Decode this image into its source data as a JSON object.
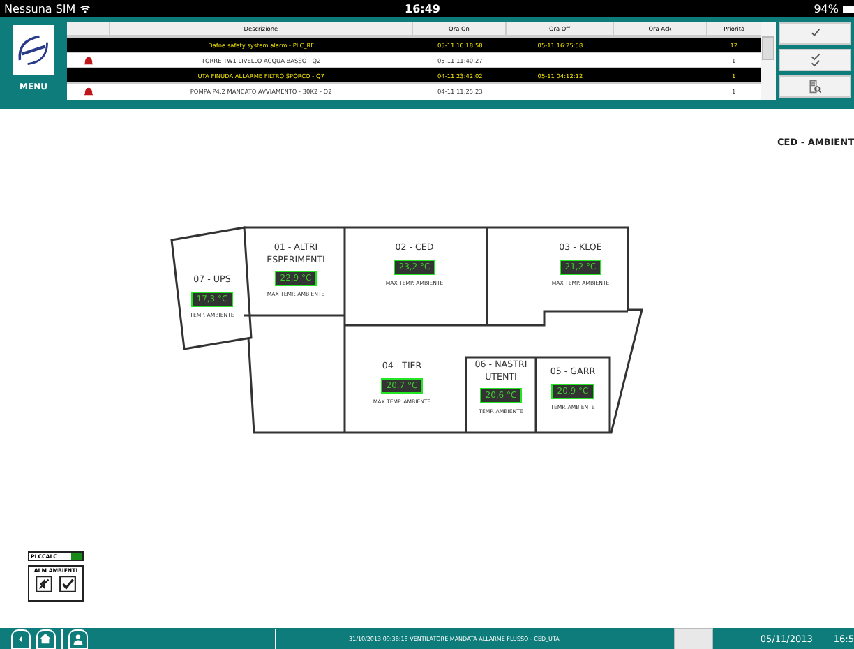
{
  "status_bar": {
    "carrier": "Nessuna SIM",
    "time": "16:49",
    "battery": "94%"
  },
  "menu": {
    "label": "MENU"
  },
  "alarms": {
    "columns": [
      "Descrizione",
      "Ora On",
      "Ora Off",
      "Ora Ack",
      "Priorità"
    ],
    "rows": [
      {
        "kind": "unacked",
        "description": "Dafne safety system alarm - PLC_RF",
        "on": "05-11 16:18:58",
        "off": "05-11 16:25:58",
        "ack": "",
        "priority": "12"
      },
      {
        "kind": "active",
        "description": "TORRE TW1 LIVELLO ACQUA BASSO - Q2",
        "on": "05-11 11:40:27",
        "off": "",
        "ack": "",
        "priority": "1"
      },
      {
        "kind": "unacked",
        "description": "UTA FINUDA ALLARME FILTRO SPORCO - Q7",
        "on": "04-11 23:42:02",
        "off": "05-11 04:12:12",
        "ack": "",
        "priority": "1"
      },
      {
        "kind": "active",
        "description": "POMPA P4.2 MANCATO AVVIAMENTO - 30K2 - Q2",
        "on": "04-11 11:25:23",
        "off": "",
        "ack": "",
        "priority": "1"
      }
    ]
  },
  "section_title": "CED - AMBIENT",
  "rooms": [
    {
      "name": "07 - UPS",
      "temperature": "17,3 °C",
      "caption": "TEMP. AMBIENTE"
    },
    {
      "name": "01 - ALTRI ESPERIMENTI",
      "temperature": "22,9 °C",
      "caption": "MAX TEMP. AMBIENTE"
    },
    {
      "name": "02 - CED",
      "temperature": "23,2 °C",
      "caption": "MAX TEMP. AMBIENTE"
    },
    {
      "name": "03 - KLOE",
      "temperature": "21,2 °C",
      "caption": "MAX TEMP. AMBIENTE"
    },
    {
      "name": "04 - TIER",
      "temperature": "20,7 °C",
      "caption": "MAX TEMP. AMBIENTE"
    },
    {
      "name": "06 - NASTRI UTENTI",
      "temperature": "20,6 °C",
      "caption": "TEMP. AMBIENTE"
    },
    {
      "name": "05 - GARR",
      "temperature": "20,9 °C",
      "caption": "TEMP. AMBIENTE"
    }
  ],
  "legend": {
    "plc": {
      "label": "PLCCALC",
      "on": true
    },
    "alarm_label": "ALM AMBIENTI"
  },
  "bottom_bar": {
    "message": "31/10/2013 09:38:18 VENTILATORE MANDATA ALLARME FLUSSO - CED_UTA",
    "date": "05/11/2013",
    "time": "16:5"
  }
}
